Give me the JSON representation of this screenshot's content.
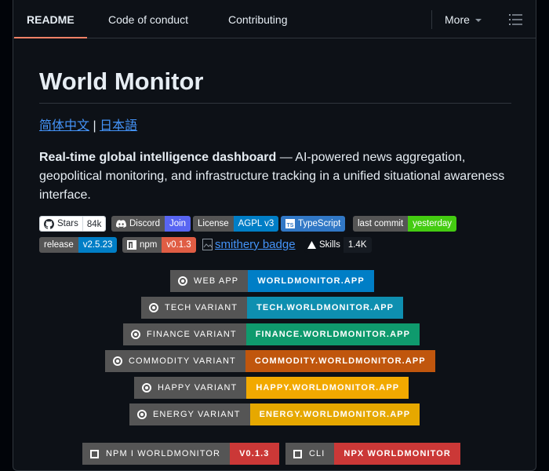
{
  "tabs": [
    {
      "label": "README",
      "active": true
    },
    {
      "label": "Code of conduct",
      "active": false
    },
    {
      "label": "Contributing",
      "active": false
    }
  ],
  "more_label": "More",
  "title": "World Monitor",
  "lang_links": {
    "zh": "简体中文",
    "sep": " | ",
    "ja": "日本語"
  },
  "intro": {
    "bold": "Real-time global intelligence dashboard",
    "rest": " — AI-powered news aggregation, geopolitical monitoring, and infrastructure tracking in a unified situational awareness interface."
  },
  "badges_row1": [
    {
      "label": "Stars",
      "value": "84k"
    },
    {
      "label": "Discord",
      "value": "Join"
    },
    {
      "label": "License",
      "value": "AGPL v3"
    },
    {
      "label": "TypeScript"
    },
    {
      "label": "last commit",
      "value": "yesterday"
    }
  ],
  "badges_row2": [
    {
      "label": "release",
      "value": "v2.5.23"
    },
    {
      "label": "npm",
      "value": "v0.1.3"
    },
    {
      "label": "smithery badge"
    },
    {
      "label": "Skills",
      "value": "1.4K"
    }
  ],
  "variants": [
    {
      "label": "WEB APP",
      "value": "WORLDMONITOR.APP",
      "color": "#007ec6"
    },
    {
      "label": "TECH VARIANT",
      "value": "TECH.WORLDMONITOR.APP",
      "color": "#0e8fb0"
    },
    {
      "label": "FINANCE VARIANT",
      "value": "FINANCE.WORLDMONITOR.APP",
      "color": "#0f9a6d"
    },
    {
      "label": "COMMODITY VARIANT",
      "value": "COMMODITY.WORLDMONITOR.APP",
      "color": "#c0560d"
    },
    {
      "label": "HAPPY VARIANT",
      "value": "HAPPY.WORLDMONITOR.APP",
      "color": "#f2a900"
    },
    {
      "label": "ENERGY VARIANT",
      "value": "ENERGY.WORLDMONITOR.APP",
      "color": "#e6a800"
    }
  ],
  "bottom_pills": [
    {
      "label": "NPM I WORLDMONITOR",
      "value": "V0.1.3",
      "color": "#cb3837"
    },
    {
      "label": "CLI",
      "value": "NPX WORLDMONITOR",
      "color": "#cb3837"
    }
  ],
  "colors": {
    "tab_underline": "#f78166",
    "link": "#4493f8",
    "badge_label": "#555555"
  }
}
